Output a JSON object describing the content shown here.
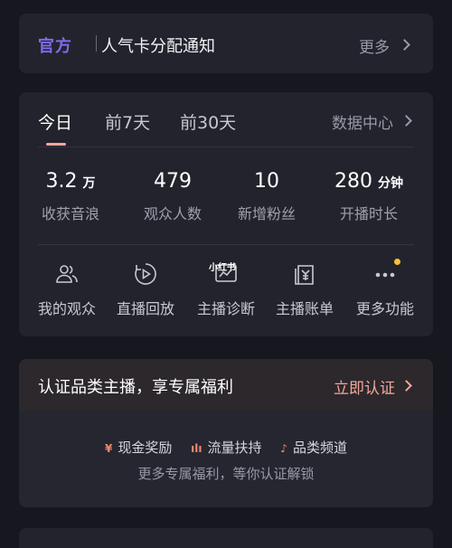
{
  "notice": {
    "tag": "官方",
    "text": "人气卡分配通知",
    "more": "更多"
  },
  "stats": {
    "tabs": [
      {
        "label": "今日",
        "active": true
      },
      {
        "label": "前7天",
        "active": false
      },
      {
        "label": "前30天",
        "active": false
      }
    ],
    "data_center": "数据中心",
    "items": [
      {
        "value": "3.2",
        "unit": "万",
        "label": "收获音浪"
      },
      {
        "value": "479",
        "unit": "",
        "label": "观众人数"
      },
      {
        "value": "10",
        "unit": "",
        "label": "新增粉丝"
      },
      {
        "value": "280",
        "unit": "分钟",
        "label": "开播时长"
      }
    ],
    "actions": [
      {
        "label": "我的观众",
        "icon": "audience-icon"
      },
      {
        "label": "直播回放",
        "icon": "replay-icon"
      },
      {
        "label": "主播诊断",
        "icon": "diagnosis-icon",
        "badge_text": "小红书"
      },
      {
        "label": "主播账单",
        "icon": "bill-icon"
      },
      {
        "label": "更多功能",
        "icon": "more-icon",
        "dot": true
      }
    ]
  },
  "cert": {
    "title": "认证品类主播，享专属福利",
    "action": "立即认证",
    "perks": [
      {
        "icon_text": "¥",
        "label": "现金奖励"
      },
      {
        "icon_text": "ılı",
        "label": "流量扶持"
      },
      {
        "icon_text": "♪",
        "label": "品类频道"
      }
    ],
    "subtitle": "更多专属福利，等你认证解锁"
  },
  "colors": {
    "background": "#17171f",
    "card": "#23232d",
    "accent_purple": "#7b6df0",
    "accent_salmon": "#f2a79a",
    "dot_yellow": "#f5c13b"
  }
}
